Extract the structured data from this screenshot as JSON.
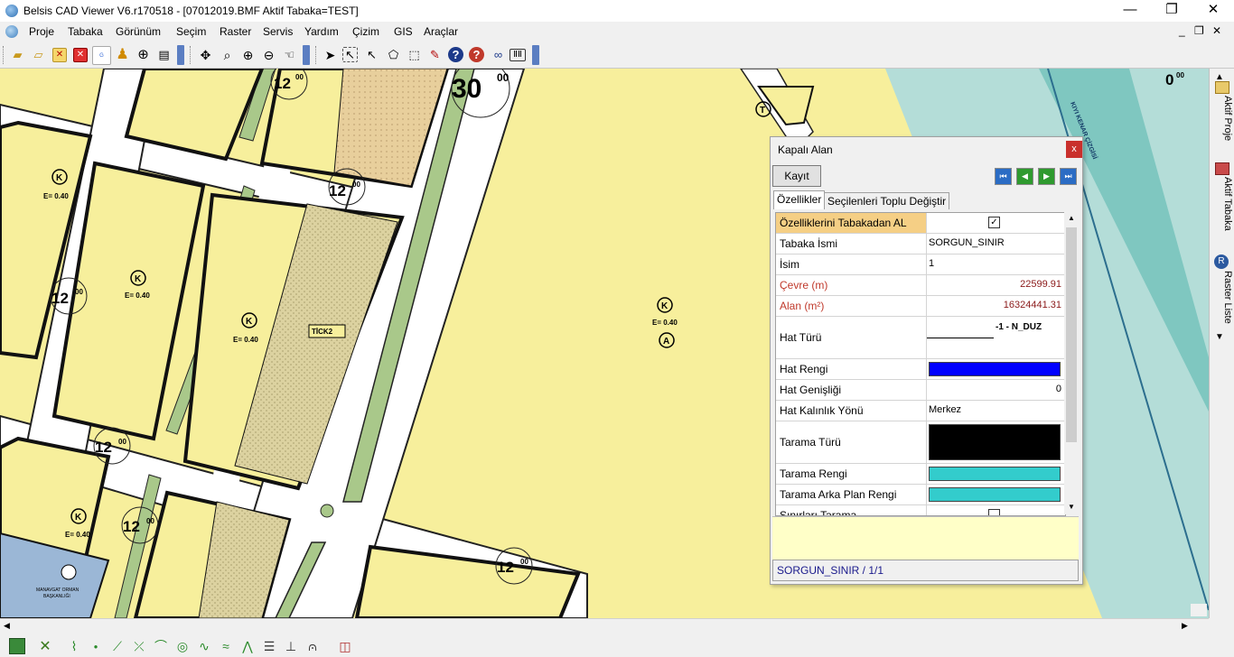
{
  "window": {
    "title": "Belsis CAD Viewer V6.r170518 - [07012019.BMF  Aktif Tabaka=TEST]",
    "minimize_glyph": "—",
    "maximize_glyph": "❐",
    "close_glyph": "✕"
  },
  "menu": {
    "items": [
      "Proje",
      "Tabaka",
      "Görünüm",
      "Seçim",
      "Raster",
      "Servis",
      "Yardım",
      "Çizim",
      "GIS",
      "Araçlar"
    ],
    "mdi_minimize": "_",
    "mdi_restore": "❐",
    "mdi_close": "✕"
  },
  "toolbar": {
    "icons": [
      "open-folder-icon",
      "open-file-icon",
      "close-doc-icon",
      "close-red-icon",
      "google-icon",
      "pin-icon",
      "target-icon",
      "print-icon",
      "pan-move-icon",
      "zoom-window-icon",
      "zoom-in-icon",
      "zoom-out-icon",
      "zoom-hand-icon",
      "select-arrow-icon",
      "select-box-icon",
      "select-plus-icon",
      "select-poly-icon",
      "select-fence-icon",
      "select-dblclick-icon",
      "help-icon",
      "help-red-icon",
      "binoculars-icon",
      "measure-icon"
    ]
  },
  "map": {
    "labels": [
      {
        "text": "12",
        "sup": "00"
      },
      {
        "text": "30",
        "sup": "00"
      },
      {
        "text": "12",
        "sup": "00"
      },
      {
        "text": "12",
        "sup": "00"
      },
      {
        "text": "12",
        "sup": "00"
      },
      {
        "text": "12",
        "sup": "00"
      },
      {
        "text": "12",
        "sup": "00"
      },
      {
        "text": "0",
        "sup": "00"
      }
    ],
    "zone_k": "K",
    "zone_t": "T",
    "zone_a": "A",
    "e_value": "E= 0.40",
    "tick_label": "TİCK2",
    "road_label": "KIYI KENAR ÇİZGİSİ",
    "building_label_1": "MANAVGAT ORMAN",
    "building_label_2": "BAŞKANLIĞI",
    "colors": {
      "parcel": "#f7ef9c",
      "road": "#ffffff",
      "green": "#a9c88a",
      "hatched": "#d9cf9c",
      "water": "#b4ddd8",
      "blue_building": "#9bb7d6"
    }
  },
  "sidepane": {
    "tabs": [
      "Aktif Proje",
      "Aktif Tabaka",
      "Raster Liste"
    ]
  },
  "dialog": {
    "title": "Kapalı Alan",
    "close": "x",
    "save_button": "Kayıt",
    "nav": [
      "first-icon",
      "prev-icon",
      "next-icon",
      "last-icon"
    ],
    "tabs": [
      "Özellikler",
      "Seçilenleri Toplu Değiştir"
    ],
    "rows": [
      {
        "label": "Özelliklerini Tabakadan AL",
        "value": "",
        "type": "checkbox",
        "checked": true,
        "highlight": true
      },
      {
        "label": "Tabaka İsmi",
        "value": "SORGUN_SINIR",
        "type": "text"
      },
      {
        "label": "İsim",
        "value": "1",
        "type": "text"
      },
      {
        "label": "Çevre (m)",
        "value": "22599.91",
        "type": "number",
        "red": true
      },
      {
        "label": "Alan (m²)",
        "value": "16324441.31",
        "type": "number",
        "red": true
      },
      {
        "label": "Hat Türü",
        "value": "-1 - N_DUZ",
        "type": "linetype"
      },
      {
        "label": "Hat Rengi",
        "value": "",
        "type": "color",
        "color": "#0000ff"
      },
      {
        "label": "Hat Genişliği",
        "value": "0",
        "type": "number"
      },
      {
        "label": "Hat Kalınlık Yönü",
        "value": "Merkez",
        "type": "text"
      },
      {
        "label": "Tarama Türü",
        "value": "",
        "type": "color",
        "color": "#000000",
        "tall": true
      },
      {
        "label": "Tarama Rengi",
        "value": "",
        "type": "color",
        "color": "#33cccc"
      },
      {
        "label": "Tarama Arka Plan Rengi",
        "value": "",
        "type": "color",
        "color": "#33cccc"
      },
      {
        "label": "Sınırları Tarama",
        "value": "",
        "type": "checkbox",
        "checked": false
      }
    ],
    "status": "SORGUN_SINIR / 1/1"
  },
  "bottombar": {
    "icons": [
      "layer-icon",
      "cross-icon",
      "polyline-icon",
      "point-icon",
      "line-icon",
      "intersect-icon",
      "arc-icon",
      "circle-icon",
      "spline-icon",
      "wave-icon",
      "zigzag-icon",
      "text-list-icon",
      "dimension-icon",
      "bridge-icon",
      "layer-stack-icon"
    ]
  }
}
